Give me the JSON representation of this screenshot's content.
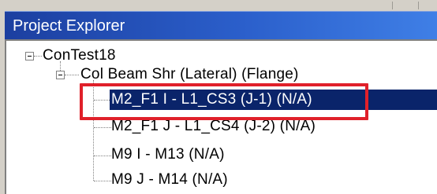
{
  "panel": {
    "title": "Project Explorer"
  },
  "tree": {
    "root": {
      "label": "ConTest18",
      "icon": "collapse-minus-icon"
    },
    "group": {
      "label": "Col Beam Shr (Lateral) (Flange)",
      "icon": "collapse-minus-icon"
    },
    "items": [
      {
        "label": "M2_F1 I - L1_CS3 (J-1)    (N/A)",
        "selected": true
      },
      {
        "label": "M2_F1 J - L1_CS4 (J-2)    (N/A)",
        "selected": false
      },
      {
        "label": "M9 I - M13  (N/A)",
        "selected": false
      },
      {
        "label": "M9 J - M14  (N/A)",
        "selected": false
      }
    ]
  },
  "colors": {
    "title_bar": "#2b5fcb",
    "selection": "#0a246a",
    "annotation_box": "#e0202a"
  }
}
